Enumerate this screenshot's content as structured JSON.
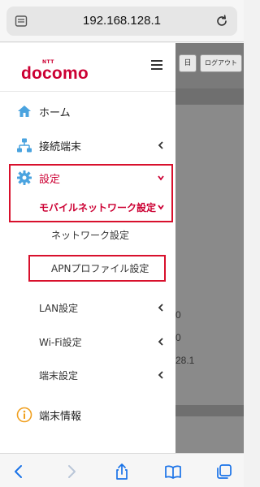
{
  "browser": {
    "url": "192.168.128.1",
    "tabs_icon": "tabs-icon",
    "reload_icon": "reload-icon"
  },
  "background_page": {
    "lang_button": "日",
    "logout_button": "ログアウト",
    "values": [
      "0",
      "0",
      "28.1"
    ]
  },
  "drawer": {
    "logo_small": "NTT",
    "logo": "docomo",
    "menu_icon": "hamburger-icon",
    "items": [
      {
        "label": "ホーム",
        "icon": "home-icon"
      },
      {
        "label": "接続端末",
        "icon": "network-tree-icon"
      },
      {
        "label": "設定",
        "icon": "gear-icon"
      },
      {
        "label": "モバイルネットワーク設定"
      },
      {
        "label": "ネットワーク設定"
      },
      {
        "label": "APNプロファイル設定"
      },
      {
        "label": "LAN設定"
      },
      {
        "label": "Wi-Fi設定"
      },
      {
        "label": "端末設定"
      },
      {
        "label": "端末情報",
        "icon": "info-icon"
      }
    ]
  },
  "colors": {
    "brand": "#cc0033",
    "highlight_box": "#d8102c",
    "ios_blue": "#1a73e8"
  },
  "toolbar": {
    "icons": [
      "back-icon",
      "forward-icon",
      "share-icon",
      "bookmarks-icon",
      "tabs-overview-icon"
    ]
  }
}
